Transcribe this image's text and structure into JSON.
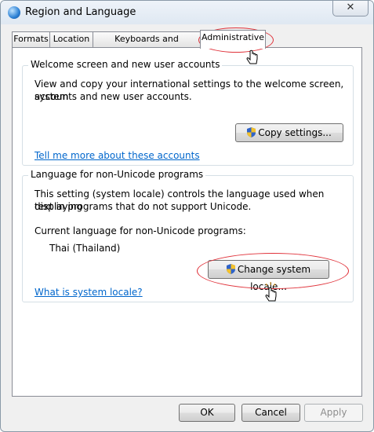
{
  "window": {
    "title": "Region and Language",
    "close_glyph": "✕"
  },
  "tabs": [
    {
      "label": "Formats"
    },
    {
      "label": "Location"
    },
    {
      "label": "Keyboards and Languages"
    },
    {
      "label": "Administrative"
    }
  ],
  "welcome": {
    "title": "Welcome screen and new user accounts",
    "text_line1": "View and copy your international settings to the welcome screen, system",
    "text_line2": "accounts and new user accounts.",
    "copy_button": "Copy settings...",
    "link": "Tell me more about these accounts"
  },
  "nonunicode": {
    "title": "Language for non-Unicode programs",
    "text_line1": "This setting (system locale) controls the language used when displaying",
    "text_line2": "text in programs that do not support Unicode.",
    "current_label": "Current language for non-Unicode programs:",
    "current_value": "Thai (Thailand)",
    "change_button": "Change system locale...",
    "link": "What is system locale?"
  },
  "footer": {
    "ok": "OK",
    "cancel": "Cancel",
    "apply": "Apply"
  },
  "icons": [
    "globe-icon",
    "close-icon",
    "uac-shield-icon",
    "hand-cursor-icon"
  ],
  "colors": {
    "link": "#0066cc",
    "annotation": "#e0323a"
  }
}
